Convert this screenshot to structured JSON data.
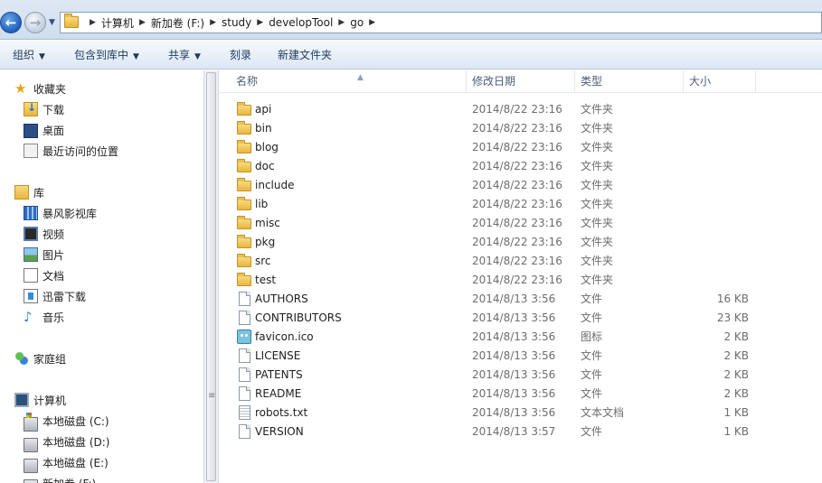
{
  "address": {
    "breadcrumbs": [
      "计算机",
      "新加卷 (F:)",
      "study",
      "developTool",
      "go"
    ]
  },
  "toolbar": {
    "organize": "组织",
    "include_in_library": "包含到库中",
    "share": "共享",
    "burn": "刻录",
    "new_folder": "新建文件夹"
  },
  "nav": {
    "favorites": {
      "label": "收藏夹",
      "items": [
        "下载",
        "桌面",
        "最近访问的位置"
      ]
    },
    "libraries": {
      "label": "库",
      "items": [
        "暴风影视库",
        "视频",
        "图片",
        "文档",
        "迅雷下载",
        "音乐"
      ]
    },
    "homegroup": {
      "label": "家庭组"
    },
    "computer": {
      "label": "计算机",
      "items": [
        "本地磁盘 (C:)",
        "本地磁盘 (D:)",
        "本地磁盘 (E:)",
        "新加卷 (F:)"
      ]
    }
  },
  "columns": {
    "name": "名称",
    "date": "修改日期",
    "type": "类型",
    "size": "大小"
  },
  "files": [
    {
      "name": "api",
      "date": "2014/8/22 23:16",
      "type": "文件夹",
      "size": "",
      "icon": "folder-icon"
    },
    {
      "name": "bin",
      "date": "2014/8/22 23:16",
      "type": "文件夹",
      "size": "",
      "icon": "folder-icon"
    },
    {
      "name": "blog",
      "date": "2014/8/22 23:16",
      "type": "文件夹",
      "size": "",
      "icon": "folder-icon"
    },
    {
      "name": "doc",
      "date": "2014/8/22 23:16",
      "type": "文件夹",
      "size": "",
      "icon": "folder-icon"
    },
    {
      "name": "include",
      "date": "2014/8/22 23:16",
      "type": "文件夹",
      "size": "",
      "icon": "folder-icon"
    },
    {
      "name": "lib",
      "date": "2014/8/22 23:16",
      "type": "文件夹",
      "size": "",
      "icon": "folder-icon"
    },
    {
      "name": "misc",
      "date": "2014/8/22 23:16",
      "type": "文件夹",
      "size": "",
      "icon": "folder-icon"
    },
    {
      "name": "pkg",
      "date": "2014/8/22 23:16",
      "type": "文件夹",
      "size": "",
      "icon": "folder-icon"
    },
    {
      "name": "src",
      "date": "2014/8/22 23:16",
      "type": "文件夹",
      "size": "",
      "icon": "folder-icon"
    },
    {
      "name": "test",
      "date": "2014/8/22 23:16",
      "type": "文件夹",
      "size": "",
      "icon": "folder-icon"
    },
    {
      "name": "AUTHORS",
      "date": "2014/8/13 3:56",
      "type": "文件",
      "size": "16 KB",
      "icon": "file-icon"
    },
    {
      "name": "CONTRIBUTORS",
      "date": "2014/8/13 3:56",
      "type": "文件",
      "size": "23 KB",
      "icon": "file-icon"
    },
    {
      "name": "favicon.ico",
      "date": "2014/8/13 3:56",
      "type": "图标",
      "size": "2 KB",
      "icon": "image-icon"
    },
    {
      "name": "LICENSE",
      "date": "2014/8/13 3:56",
      "type": "文件",
      "size": "2 KB",
      "icon": "file-icon"
    },
    {
      "name": "PATENTS",
      "date": "2014/8/13 3:56",
      "type": "文件",
      "size": "2 KB",
      "icon": "file-icon"
    },
    {
      "name": "README",
      "date": "2014/8/13 3:56",
      "type": "文件",
      "size": "2 KB",
      "icon": "file-icon"
    },
    {
      "name": "robots.txt",
      "date": "2014/8/13 3:56",
      "type": "文本文档",
      "size": "1 KB",
      "icon": "text-file-icon"
    },
    {
      "name": "VERSION",
      "date": "2014/8/13 3:57",
      "type": "文件",
      "size": "1 KB",
      "icon": "file-icon"
    }
  ]
}
